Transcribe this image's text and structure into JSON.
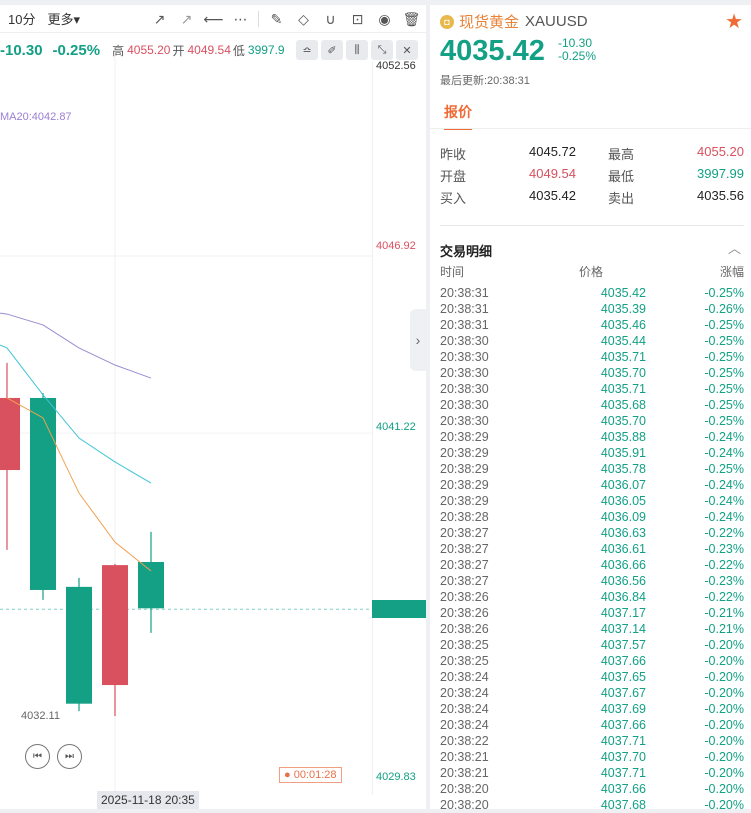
{
  "toolbar": {
    "timeframe": "10分",
    "more": "更多▾"
  },
  "infobar": {
    "change": "-10.30",
    "pct": "-0.25%",
    "high_label": "高",
    "high": "4055.20",
    "open_label": "开",
    "open": "4049.54",
    "low_label": "低",
    "low": "3997.9"
  },
  "ma_label": "MA20:4042.87",
  "axis": {
    "top": "4052.56",
    "l1": "4046.92",
    "l2": "4041.22",
    "bottom": "4029.83",
    "low_marker": "4032.11"
  },
  "timer": "00:01:28",
  "date_tag": "2025-11-18 20:35",
  "colors": {
    "up": "#d9505f",
    "down": "#13a085",
    "ma5": "#f0a050",
    "ma10": "#40c4d8",
    "ma20": "#9b8ad0"
  },
  "candles": [
    {
      "o": 4039.87,
      "h": 4043.32,
      "l": 4037.3,
      "c": 4042.19
    },
    {
      "o": 4042.19,
      "h": 4042.35,
      "l": 4035.69,
      "c": 4036.01
    },
    {
      "o": 4036.11,
      "h": 4036.4,
      "l": 4032.11,
      "c": 4032.35
    },
    {
      "o": 4032.95,
      "h": 4036.85,
      "l": 4031.95,
      "c": 4036.81
    },
    {
      "o": 4036.91,
      "h": 4037.88,
      "l": 4034.63,
      "c": 4035.42
    }
  ],
  "ma": {
    "ma20": [
      4044.92,
      4044.89,
      4044.54,
      4043.8,
      4043.25,
      4042.83
    ],
    "ma10": [
      4043.89,
      4043.8,
      4042.29,
      4040.9,
      4040.13,
      4039.45
    ],
    "ma5": [
      null,
      4042.19,
      4041.55,
      4039.13,
      4037.55,
      4036.62
    ]
  },
  "quote": {
    "name": "现货黄金",
    "symbol": "XAUUSD",
    "price": "4035.42",
    "change": "-10.30",
    "pct": "-0.25%",
    "updated": "最后更新:20:38:31",
    "tab": "报价",
    "fields": [
      {
        "k": "昨收",
        "v": "4045.72"
      },
      {
        "k": "开盘",
        "v": "4049.54"
      },
      {
        "k": "买入",
        "v": "4035.42"
      },
      {
        "k": "最高",
        "v": "4055.20"
      },
      {
        "k": "最低",
        "v": "3997.99"
      },
      {
        "k": "卖出",
        "v": "4035.56"
      }
    ]
  },
  "trades": {
    "title": "交易明细",
    "headers": [
      "时间",
      "价格",
      "涨幅"
    ],
    "rows": [
      [
        "20:38:31",
        "4035.42",
        "-0.25%"
      ],
      [
        "20:38:31",
        "4035.39",
        "-0.26%"
      ],
      [
        "20:38:31",
        "4035.46",
        "-0.25%"
      ],
      [
        "20:38:30",
        "4035.44",
        "-0.25%"
      ],
      [
        "20:38:30",
        "4035.71",
        "-0.25%"
      ],
      [
        "20:38:30",
        "4035.70",
        "-0.25%"
      ],
      [
        "20:38:30",
        "4035.71",
        "-0.25%"
      ],
      [
        "20:38:30",
        "4035.68",
        "-0.25%"
      ],
      [
        "20:38:30",
        "4035.70",
        "-0.25%"
      ],
      [
        "20:38:29",
        "4035.88",
        "-0.24%"
      ],
      [
        "20:38:29",
        "4035.91",
        "-0.24%"
      ],
      [
        "20:38:29",
        "4035.78",
        "-0.25%"
      ],
      [
        "20:38:29",
        "4036.07",
        "-0.24%"
      ],
      [
        "20:38:29",
        "4036.05",
        "-0.24%"
      ],
      [
        "20:38:28",
        "4036.09",
        "-0.24%"
      ],
      [
        "20:38:27",
        "4036.63",
        "-0.22%"
      ],
      [
        "20:38:27",
        "4036.61",
        "-0.23%"
      ],
      [
        "20:38:27",
        "4036.66",
        "-0.22%"
      ],
      [
        "20:38:27",
        "4036.56",
        "-0.23%"
      ],
      [
        "20:38:26",
        "4036.84",
        "-0.22%"
      ],
      [
        "20:38:26",
        "4037.17",
        "-0.21%"
      ],
      [
        "20:38:26",
        "4037.14",
        "-0.21%"
      ],
      [
        "20:38:25",
        "4037.57",
        "-0.20%"
      ],
      [
        "20:38:25",
        "4037.66",
        "-0.20%"
      ],
      [
        "20:38:24",
        "4037.65",
        "-0.20%"
      ],
      [
        "20:38:24",
        "4037.67",
        "-0.20%"
      ],
      [
        "20:38:24",
        "4037.69",
        "-0.20%"
      ],
      [
        "20:38:24",
        "4037.66",
        "-0.20%"
      ],
      [
        "20:38:22",
        "4037.71",
        "-0.20%"
      ],
      [
        "20:38:21",
        "4037.70",
        "-0.20%"
      ],
      [
        "20:38:21",
        "4037.71",
        "-0.20%"
      ],
      [
        "20:38:20",
        "4037.66",
        "-0.20%"
      ],
      [
        "20:38:20",
        "4037.68",
        "-0.20%"
      ]
    ]
  }
}
